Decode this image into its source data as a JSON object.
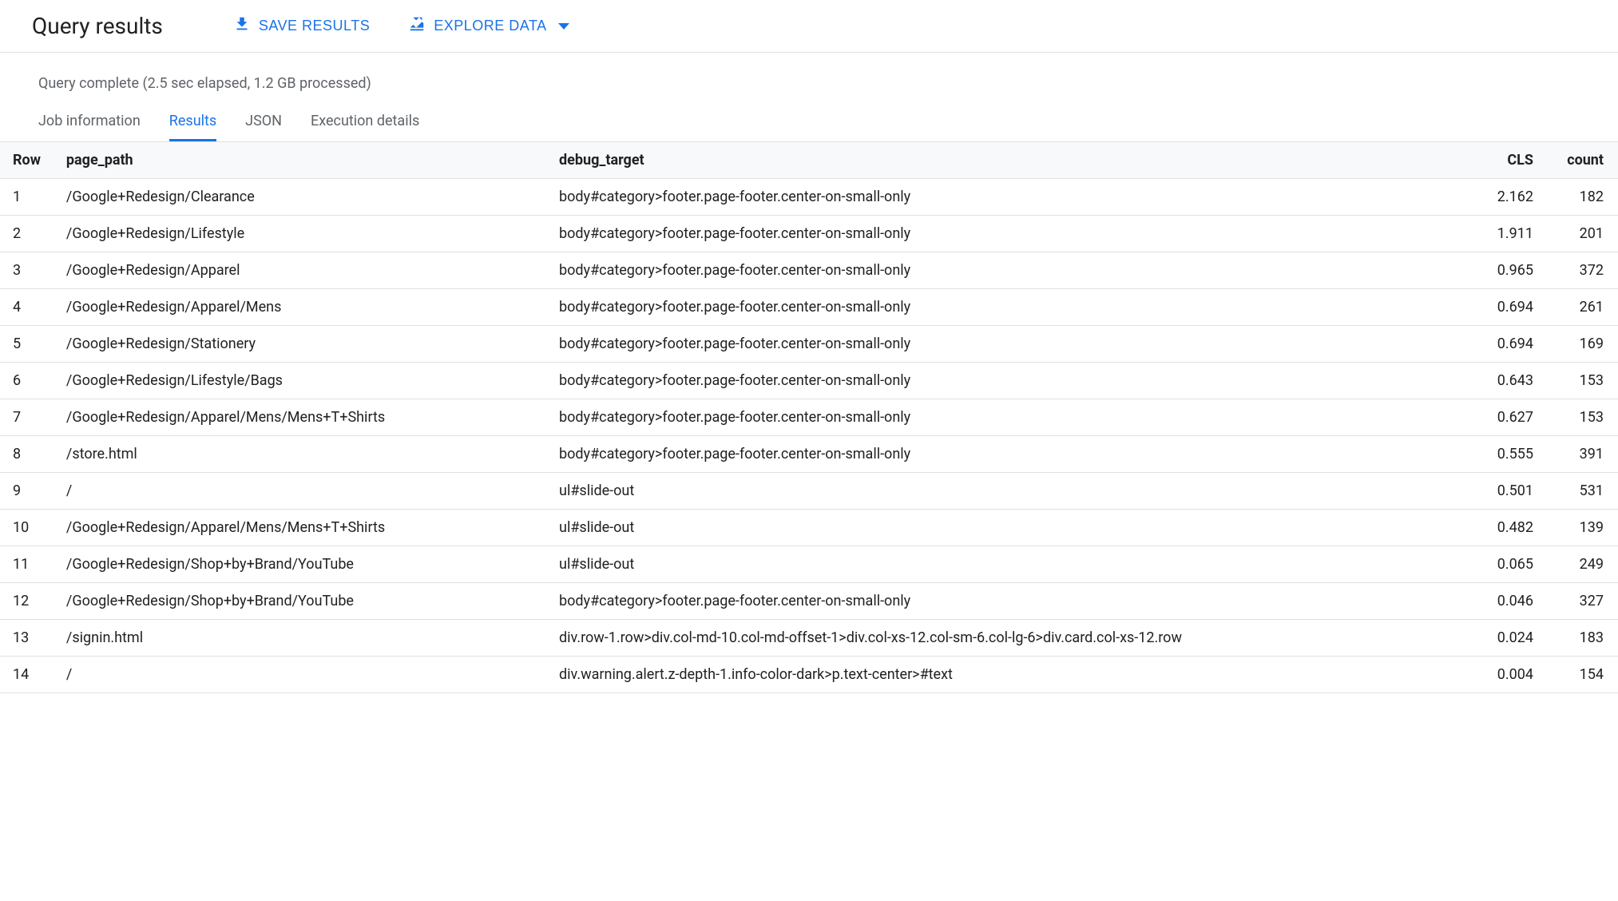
{
  "header": {
    "title": "Query results",
    "save_label": "SAVE RESULTS",
    "explore_label": "EXPLORE DATA"
  },
  "status": "Query complete (2.5 sec elapsed, 1.2 GB processed)",
  "tabs": {
    "job_info": "Job information",
    "results": "Results",
    "json": "JSON",
    "execution": "Execution details"
  },
  "columns": {
    "row": "Row",
    "page_path": "page_path",
    "debug_target": "debug_target",
    "cls": "CLS",
    "count": "count"
  },
  "rows": [
    {
      "n": "1",
      "page_path": "/Google+Redesign/Clearance",
      "debug_target": "body#category>footer.page-footer.center-on-small-only",
      "cls": "2.162",
      "count": "182"
    },
    {
      "n": "2",
      "page_path": "/Google+Redesign/Lifestyle",
      "debug_target": "body#category>footer.page-footer.center-on-small-only",
      "cls": "1.911",
      "count": "201"
    },
    {
      "n": "3",
      "page_path": "/Google+Redesign/Apparel",
      "debug_target": "body#category>footer.page-footer.center-on-small-only",
      "cls": "0.965",
      "count": "372"
    },
    {
      "n": "4",
      "page_path": "/Google+Redesign/Apparel/Mens",
      "debug_target": "body#category>footer.page-footer.center-on-small-only",
      "cls": "0.694",
      "count": "261"
    },
    {
      "n": "5",
      "page_path": "/Google+Redesign/Stationery",
      "debug_target": "body#category>footer.page-footer.center-on-small-only",
      "cls": "0.694",
      "count": "169"
    },
    {
      "n": "6",
      "page_path": "/Google+Redesign/Lifestyle/Bags",
      "debug_target": "body#category>footer.page-footer.center-on-small-only",
      "cls": "0.643",
      "count": "153"
    },
    {
      "n": "7",
      "page_path": "/Google+Redesign/Apparel/Mens/Mens+T+Shirts",
      "debug_target": "body#category>footer.page-footer.center-on-small-only",
      "cls": "0.627",
      "count": "153"
    },
    {
      "n": "8",
      "page_path": "/store.html",
      "debug_target": "body#category>footer.page-footer.center-on-small-only",
      "cls": "0.555",
      "count": "391"
    },
    {
      "n": "9",
      "page_path": "/",
      "debug_target": "ul#slide-out",
      "cls": "0.501",
      "count": "531"
    },
    {
      "n": "10",
      "page_path": "/Google+Redesign/Apparel/Mens/Mens+T+Shirts",
      "debug_target": "ul#slide-out",
      "cls": "0.482",
      "count": "139"
    },
    {
      "n": "11",
      "page_path": "/Google+Redesign/Shop+by+Brand/YouTube",
      "debug_target": "ul#slide-out",
      "cls": "0.065",
      "count": "249"
    },
    {
      "n": "12",
      "page_path": "/Google+Redesign/Shop+by+Brand/YouTube",
      "debug_target": "body#category>footer.page-footer.center-on-small-only",
      "cls": "0.046",
      "count": "327"
    },
    {
      "n": "13",
      "page_path": "/signin.html",
      "debug_target": "div.row-1.row>div.col-md-10.col-md-offset-1>div.col-xs-12.col-sm-6.col-lg-6>div.card.col-xs-12.row",
      "cls": "0.024",
      "count": "183"
    },
    {
      "n": "14",
      "page_path": "/",
      "debug_target": "div.warning.alert.z-depth-1.info-color-dark>p.text-center>#text",
      "cls": "0.004",
      "count": "154"
    }
  ]
}
